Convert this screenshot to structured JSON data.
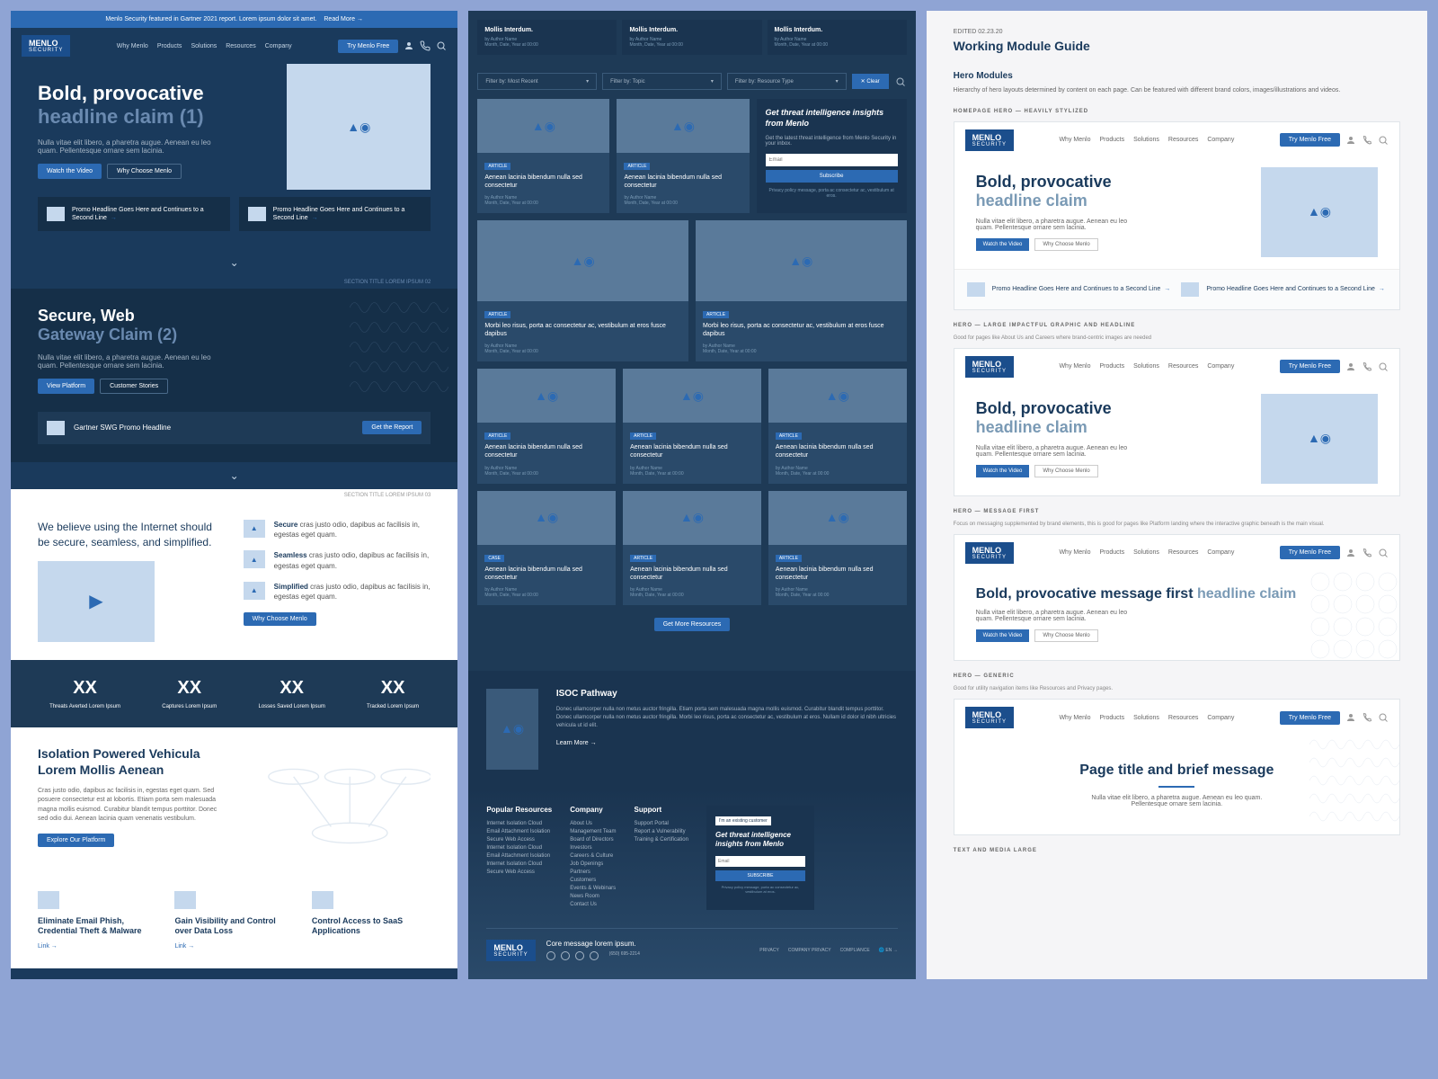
{
  "brand": {
    "name": "MENLO",
    "sub": "SECURITY"
  },
  "nav": {
    "items": [
      "Why Menlo",
      "Products",
      "Solutions",
      "Resources",
      "Company"
    ],
    "cta": "Try Menlo Free"
  },
  "col1": {
    "announce": {
      "text": "Menlo Security featured in Gartner 2021 report. Lorem ipsum dolor sit amet.",
      "link": "Read More →"
    },
    "hero": {
      "title1": "Bold, provocative",
      "title2": "headline claim (1)",
      "body": "Nulla vitae elit libero, a pharetra augue. Aenean eu leo quam. Pellentesque ornare sem lacinia.",
      "btn1": "Watch the Video",
      "btn2": "Why Choose Menlo"
    },
    "promos": [
      {
        "text": "Promo Headline Goes Here and Continues to a Second Line"
      },
      {
        "text": "Promo Headline Goes Here and Continues to a Second Line"
      }
    ],
    "meta1": "SECTION TITLE LOREM IPSUM 02",
    "sec2": {
      "title1": "Secure, Web",
      "title2": "Gateway Claim (2)",
      "body": "Nulla vitae elit libero, a pharetra augue. Aenean eu leo quam. Pellentesque ornare sem lacinia.",
      "btn1": "View Platform",
      "btn2": "Customer Stories"
    },
    "swg": {
      "title": "Gartner SWG Promo Headline",
      "btn": "Get the Report"
    },
    "meta2": "SECTION TITLE LOREM IPSUM 03",
    "believe": {
      "text": "We believe using the Internet should be secure, seamless, and simplified.",
      "btn": "Why Choose Menlo"
    },
    "features": [
      {
        "title": "Secure",
        "text": "cras justo odio, dapibus ac facilisis in, egestas eget quam."
      },
      {
        "title": "Seamless",
        "text": "cras justo odio, dapibus ac facilisis in, egestas eget quam."
      },
      {
        "title": "Simplified",
        "text": "cras justo odio, dapibus ac facilisis in, egestas eget quam."
      }
    ],
    "stats": [
      {
        "val": "XX",
        "label": "Threats Averted Lorem Ipsum"
      },
      {
        "val": "XX",
        "label": "Captures Lorem Ipsum"
      },
      {
        "val": "XX",
        "label": "Losses Saved Lorem Ipsum"
      },
      {
        "val": "XX",
        "label": "Tracked Lorem Ipsum"
      }
    ],
    "isolation": {
      "title": "Isolation Powered Vehicula Lorem Mollis Aenean",
      "body": "Cras justo odio, dapibus ac facilisis in, egestas eget quam. Sed posuere consectetur est at lobortis. Etiam porta sem malesuada magna mollis euismod. Curabitur blandit tempus porttitor. Donec sed odio dui. Aenean lacinia quam venenatis vestibulum.",
      "btn": "Explore Our Platform"
    },
    "feat3": [
      {
        "title": "Eliminate Email Phish, Credential Theft & Malware",
        "link": "Link →"
      },
      {
        "title": "Gain Visibility and Control over Data Loss",
        "link": "Link →"
      },
      {
        "title": "Control Access to SaaS Applications",
        "link": ""
      }
    ]
  },
  "col2": {
    "top": [
      {
        "title": "Mollis Interdum.",
        "byline": "by Author Name",
        "date": "Month, Date, Year at 00:00"
      },
      {
        "title": "Mollis Interdum.",
        "byline": "by Author Name",
        "date": "Month, Date, Year at 00:00"
      },
      {
        "title": "Mollis Interdum.",
        "byline": "by Author Name",
        "date": "Month, Date, Year at 00:00"
      }
    ],
    "filters": {
      "f1": "Filter by: Most Recent",
      "f2": "Filter by: Topic",
      "f3": "Filter by: Resource Type",
      "clear": "✕ Clear"
    },
    "threat": {
      "title": "Get threat intelligence insights from Menlo",
      "body": "Get the latest threat intelligence from Menlo Security in your inbox.",
      "placeholder": "Email",
      "btn": "Subscribe",
      "fine": "Privacy policy message, porta ac consectetur ac, vestibulum at eros."
    },
    "cards": {
      "tag_article": "ARTICLE",
      "tag_case": "CASE",
      "title1": "Aenean lacinia bibendum nulla sed consectetur",
      "title2": "Morbi leo risus, porta ac consectetur ac, vestibulum at eros fusce dapibus",
      "byline": "by Author Name",
      "date": "Month, Date, Year at 00:00"
    },
    "getmore": "Get More Resources",
    "isoc": {
      "title": "ISOC Pathway",
      "body": "Donec ullamcorper nulla non metus auctor fringilla. Etiam porta sem malesuada magna mollis euismod. Curabitur blandit tempus porttitor. Donec ullamcorper nulla non metus auctor fringilla. Morbi leo risus, porta ac consectetur ac, vestibulum at eros. Nullam id dolor id nibh ultricies vehicula ut id elit.",
      "link": "Learn More →"
    },
    "footer": {
      "cols": [
        {
          "title": "Popular Resources",
          "links": [
            "Internet Isolation Cloud",
            "Email Attachment Isolation",
            "Secure Web Access",
            "Internet Isolation Cloud",
            "Email Attachment Isolation",
            "Internet Isolation Cloud",
            "Secure Web Access"
          ]
        },
        {
          "title": "Company",
          "links": [
            "About Us",
            "Management Team",
            "Board of Directors",
            "Investors",
            "Careers & Culture",
            "Job Openings",
            "Partners",
            "Customers",
            "Events & Webinars",
            "News Room",
            "Contact Us"
          ]
        },
        {
          "title": "Support",
          "links": [
            "Support Portal",
            "Report a Vulnerability",
            "Training & Certification"
          ]
        }
      ],
      "signup": {
        "tag": "I'm an existing customer",
        "title": "Get threat intelligence insights from Menlo",
        "placeholder": "Email",
        "btn": "SUBSCRIBE",
        "fine": "Privacy policy message, porta ac consectetur ac, vestibulum at eros."
      },
      "msg": "Core message lorem ipsum.",
      "phone": "(650) 695-2214",
      "links": [
        "PRIVACY",
        "COMPANY PRIVACY",
        "COMPLIANCE"
      ],
      "lang": "EN →"
    }
  },
  "col3": {
    "date": "EDITED 02.23.20",
    "title": "Working Module Guide",
    "sec_title": "Hero Modules",
    "sec_desc": "Hierarchy of hero layouts determined by content on each page. Can be featured with different brand colors, images/illustrations and videos.",
    "m1": {
      "label": "HOMEPAGE HERO — HEAVILY STYLIZED",
      "title1": "Bold, provocative",
      "title2": "headline claim",
      "body": "Nulla vitae elit libero, a pharetra augue. Aenean eu leo quam. Pellentesque ornare sem lacinia.",
      "btn1": "Watch the Video",
      "btn2": "Why Choose Menlo",
      "promos": [
        {
          "text": "Promo Headline Goes Here and Continues to a Second Line"
        },
        {
          "text": "Promo Headline Goes Here and Continues to a Second Line"
        }
      ]
    },
    "m2": {
      "label": "HERO — LARGE IMPACTFUL GRAPHIC AND HEADLINE",
      "hint": "Good for pages like About Us and Careers where brand-centric images are needed",
      "title1": "Bold, provocative",
      "title2": "headline claim",
      "body": "Nulla vitae elit libero, a pharetra augue. Aenean eu leo quam. Pellentesque ornare sem lacinia.",
      "btn1": "Watch the Video",
      "btn2": "Why Choose Menlo"
    },
    "m3": {
      "label": "HERO — MESSAGE FIRST",
      "hint": "Focus on messaging supplemented by brand elements, this is good for pages like Platform landing where the interactive graphic beneath is the main visual.",
      "title1": "Bold, provocative message first ",
      "title2": "headline claim",
      "body": "Nulla vitae elit libero, a pharetra augue. Aenean eu leo quam. Pellentesque ornare sem lacinia.",
      "btn1": "Watch the Video",
      "btn2": "Why Choose Menlo"
    },
    "m4": {
      "label": "HERO — GENERIC",
      "hint": "Good for utility navigation items like Resources and Privacy pages.",
      "title": "Page title and brief message",
      "body": "Nulla vitae elit libero, a pharetra augue. Aenean eu leo quam. Pellentesque ornare sem lacinia."
    },
    "next_label": "Text and Media Large"
  }
}
